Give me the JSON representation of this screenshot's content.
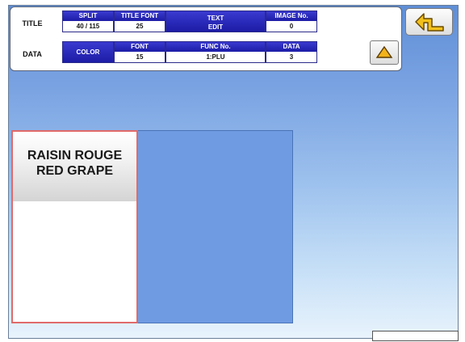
{
  "header": {
    "title_label": "TITLE",
    "data_label": "DATA",
    "split": {
      "label": "SPLIT",
      "value": "40 / 115"
    },
    "title_font": {
      "label": "TITLE FONT",
      "value": "25"
    },
    "text_edit": {
      "line1": "TEXT",
      "line2": "EDIT"
    },
    "image_no": {
      "label": "IMAGE No.",
      "value": "0"
    },
    "color_label": "COLOR",
    "font": {
      "label": "FONT",
      "value": "15"
    },
    "func_no": {
      "label": "FUNC No.",
      "value": "1:PLU"
    },
    "data": {
      "label": "DATA",
      "value": "3"
    }
  },
  "item": {
    "line1": "RAISIN ROUGE",
    "line2": "RED GRAPE"
  },
  "colors": {
    "header_blue": "#1c1ca6",
    "card_border": "#e06a6a",
    "preview_blue": "#6f9be3",
    "up_arrow_fill": "#f2b21a"
  },
  "icons": {
    "up": "up-triangle-icon",
    "back": "return-arrow-icon"
  }
}
